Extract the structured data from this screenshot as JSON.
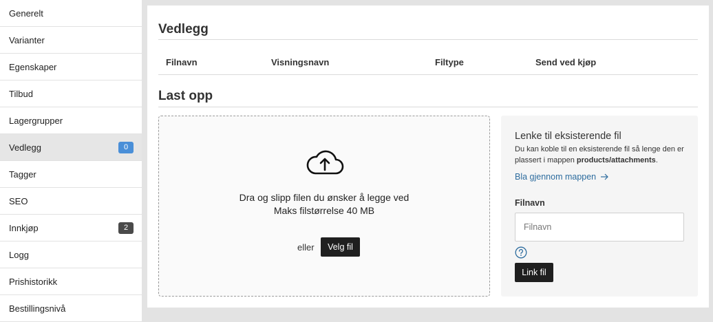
{
  "sidebar": {
    "items": [
      {
        "label": "Generelt",
        "badge": null
      },
      {
        "label": "Varianter",
        "badge": null
      },
      {
        "label": "Egenskaper",
        "badge": null
      },
      {
        "label": "Tilbud",
        "badge": null
      },
      {
        "label": "Lagergrupper",
        "badge": null
      },
      {
        "label": "Vedlegg",
        "badge": "0",
        "active": true
      },
      {
        "label": "Tagger",
        "badge": null
      },
      {
        "label": "SEO",
        "badge": null
      },
      {
        "label": "Innkjøp",
        "badge": "2"
      },
      {
        "label": "Logg",
        "badge": null
      },
      {
        "label": "Prishistorikk",
        "badge": null
      },
      {
        "label": "Bestillingsnivå",
        "badge": null
      }
    ]
  },
  "attachments": {
    "title": "Vedlegg",
    "columns": [
      "Filnavn",
      "Visningsnavn",
      "Filtype",
      "Send ved kjøp"
    ]
  },
  "upload": {
    "title": "Last opp",
    "drop_text": "Dra og slipp filen du ønsker å legge ved",
    "max_size": "Maks filstørrelse 40 MB",
    "or_text": "eller",
    "choose_button": "Velg fil"
  },
  "link_existing": {
    "title": "Lenke til eksisterende fil",
    "desc_prefix": "Du kan koble til en eksisterende fil så lenge den er plassert i mappen ",
    "desc_path": "products/attachments",
    "desc_suffix": ".",
    "browse_label": "Bla gjennom mappen",
    "field_label": "Filnavn",
    "field_placeholder": "Filnavn",
    "link_button": "Link fil"
  },
  "colors": {
    "badge_blue": "#4a8fd8",
    "badge_dark": "#4a4a4a",
    "link": "#2d6c9e",
    "button_dark": "#1f1f1f"
  }
}
